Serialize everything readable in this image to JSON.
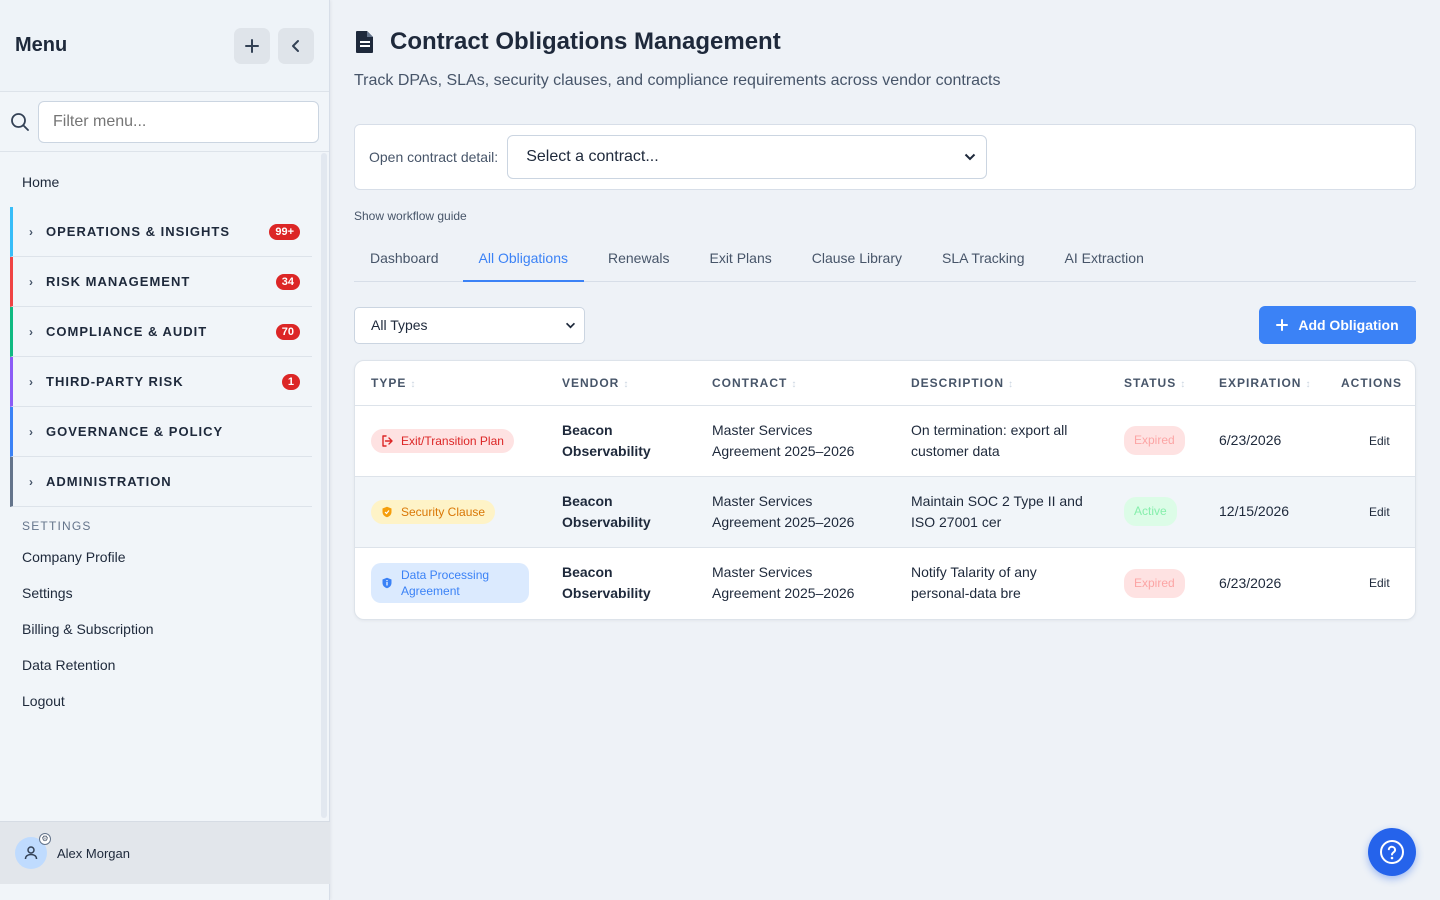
{
  "sidebar": {
    "title": "Menu",
    "filter_placeholder": "Filter menu...",
    "home": "Home",
    "groups": [
      {
        "label": "OPERATIONS & INSIGHTS",
        "badge": "99+",
        "color": "#38bdf8"
      },
      {
        "label": "RISK MANAGEMENT",
        "badge": "34",
        "color": "#ef4444"
      },
      {
        "label": "COMPLIANCE & AUDIT",
        "badge": "70",
        "color": "#10b981"
      },
      {
        "label": "THIRD-PARTY RISK",
        "badge": "1",
        "color": "#8b5cf6"
      },
      {
        "label": "GOVERNANCE & POLICY",
        "badge": "",
        "color": "#3b82f6"
      },
      {
        "label": "ADMINISTRATION",
        "badge": "",
        "color": "#64748b"
      }
    ],
    "settings_title": "SETTINGS",
    "settings_items": [
      "Company Profile",
      "Settings",
      "Billing & Subscription",
      "Data Retention",
      "Logout"
    ],
    "user": "Alex Morgan"
  },
  "header": {
    "title": "Contract Obligations Management",
    "subtitle": "Track DPAs, SLAs, security clauses, and compliance requirements across vendor contracts"
  },
  "contract_picker": {
    "label": "Open contract detail:",
    "value": "Select a contract..."
  },
  "workflow_link": "Show workflow guide",
  "tabs": [
    "Dashboard",
    "All Obligations",
    "Renewals",
    "Exit Plans",
    "Clause Library",
    "SLA Tracking",
    "AI Extraction"
  ],
  "active_tab": "All Obligations",
  "filter": {
    "type_value": "All Types"
  },
  "add_button": "Add Obligation",
  "table": {
    "columns": [
      "TYPE",
      "VENDOR",
      "CONTRACT",
      "DESCRIPTION",
      "STATUS",
      "EXPIRATION",
      "ACTIONS"
    ],
    "rows": [
      {
        "type": "Exit/Transition Plan",
        "vendor_line1": "Beacon",
        "vendor_line2": "Observability",
        "contract_line1": "Master Services",
        "contract_line2": "Agreement 2025–2026",
        "desc_line1": "On termination: export all",
        "desc_line2": "customer data",
        "status": "Expired",
        "expiration": "6/23/2026",
        "action": "Edit"
      },
      {
        "type": "Security Clause",
        "vendor_line1": "Beacon",
        "vendor_line2": "Observability",
        "contract_line1": "Master Services",
        "contract_line2": "Agreement 2025–2026",
        "desc_line1": "Maintain SOC 2 Type II and",
        "desc_line2": "ISO 27001 cer",
        "status": "Active",
        "expiration": "12/15/2026",
        "action": "Edit"
      },
      {
        "type_line1": "Data Processing",
        "type_line2": "Agreement",
        "vendor_line1": "Beacon",
        "vendor_line2": "Observability",
        "contract_line1": "Master Services",
        "contract_line2": "Agreement 2025–2026",
        "desc_line1": "Notify Talarity of any",
        "desc_line2": "personal-data bre",
        "status": "Expired",
        "expiration": "6/23/2026",
        "action": "Edit"
      }
    ]
  },
  "colors": {
    "accent": "#3b82f6",
    "danger": "#dc2626",
    "warning": "#d97706",
    "success": "#86efac"
  }
}
